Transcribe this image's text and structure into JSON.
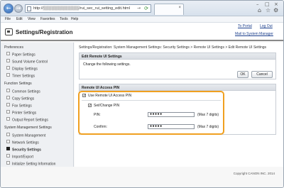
{
  "browser": {
    "url": "http://▒▒▒▒▒▒▒▒▒▒▒▒▒/rui_sec_rui_setting_edit.html",
    "tab_close": "×",
    "back_glyph": "←",
    "forward_glyph": "→",
    "go_glyph": "→",
    "refresh_glyph": "⟳",
    "minimize": "–",
    "maximize": "□",
    "close": "×",
    "home_glyph": "⌂",
    "favorites_glyph": "☆",
    "tools_glyph": "⚙"
  },
  "menu": [
    "File",
    "Edit",
    "View",
    "Favorites",
    "Tools",
    "Help"
  ],
  "app": {
    "title": "Settings/Registration",
    "to_portal": "To Portal",
    "log_out": "Log Out",
    "mail_to": "Mail to System Manager"
  },
  "sidebar": {
    "groups": [
      {
        "heading": "Preferences",
        "items": [
          "Paper Settings",
          "Sound Volume Control",
          "Display Settings",
          "Timer Settings"
        ]
      },
      {
        "heading": "Function Settings",
        "items": [
          "Common Settings",
          "Copy Settings",
          "Fax Settings",
          "Printer Settings",
          "Output Report Settings"
        ]
      },
      {
        "heading": "System Management Settings",
        "items": [
          "System Management",
          "Network Settings",
          "Security Settings",
          "Import/Export",
          "Initialize Setting Information"
        ]
      }
    ],
    "active": "Security Settings"
  },
  "main": {
    "breadcrumb": "Settings/Registration: System Management Settings: Security Settings > Remote UI Settings > Edit Remote UI Settings",
    "edit_section": {
      "title": "Edit Remote UI Settings",
      "instruction": "Change the following settings.",
      "ok_label": "OK",
      "cancel_label": "Cancel"
    },
    "pin_section": {
      "title": "Remote UI Access PIN",
      "use_pin_label": "Use Remote UI Access PIN",
      "use_pin_checked": "✓",
      "set_change_label": "Set/Change PIN",
      "set_change_checked": "✓",
      "pin_label": "PIN:",
      "pin_value": "●●●●●",
      "pin_hint": "(Max 7 digits)",
      "confirm_label": "Confirm:",
      "confirm_value": "●●●●●",
      "confirm_hint": "(Max 7 digits)"
    }
  },
  "footer": {
    "copyright": "Copyright CANON INC. 2014"
  }
}
